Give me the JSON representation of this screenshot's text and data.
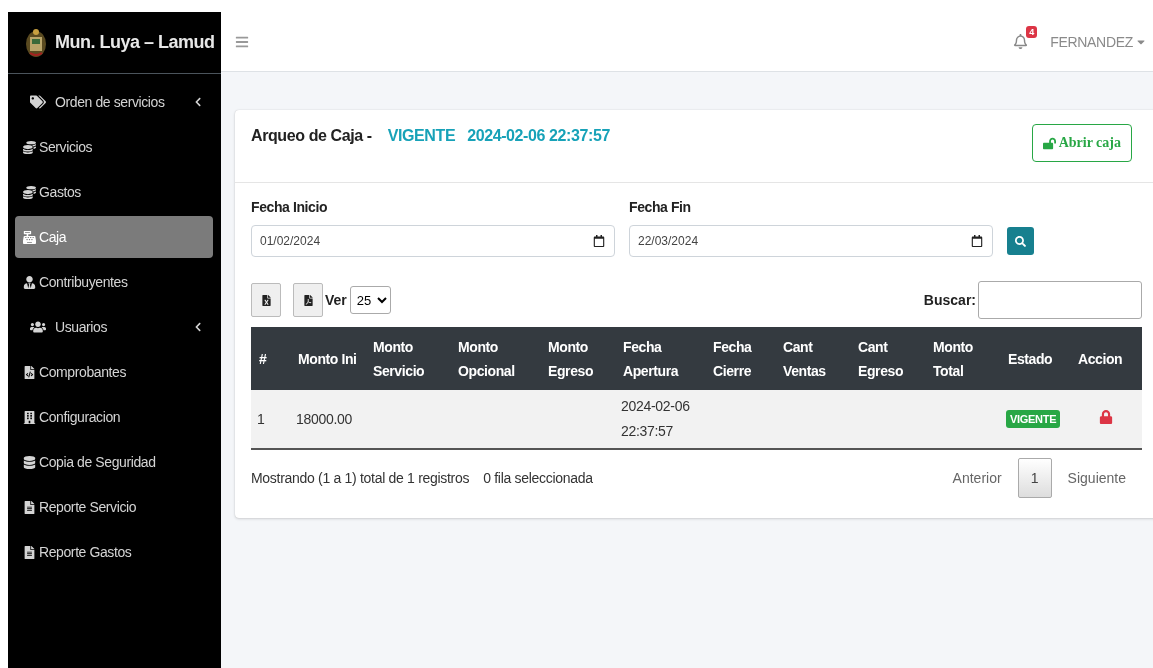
{
  "sidebar": {
    "brand": "Mun. Luya – Lamud",
    "items": [
      {
        "label": "Orden de servicios",
        "submenu": true,
        "selected": false
      },
      {
        "label": "Servicios",
        "submenu": false,
        "selected": false
      },
      {
        "label": "Gastos",
        "submenu": false,
        "selected": false
      },
      {
        "label": "Caja",
        "submenu": false,
        "selected": true
      },
      {
        "label": "Contribuyentes",
        "submenu": false,
        "selected": false
      },
      {
        "label": "Usuarios",
        "submenu": true,
        "selected": false
      },
      {
        "label": "Comprobantes",
        "submenu": false,
        "selected": false
      },
      {
        "label": "Configuracion",
        "submenu": false,
        "selected": false
      },
      {
        "label": "Copia de Seguridad",
        "submenu": false,
        "selected": false
      },
      {
        "label": "Reporte Servicio",
        "submenu": false,
        "selected": false
      },
      {
        "label": "Reporte Gastos",
        "submenu": false,
        "selected": false
      }
    ]
  },
  "topbar": {
    "notifications": "4",
    "user": "FERNANDEZ"
  },
  "card": {
    "title": "Arqueo de Caja -",
    "status": "VIGENTE",
    "datetime": "2024-02-06 22:37:57",
    "open_button": "Abrir caja"
  },
  "filters": [
    {
      "label": "Fecha Inicio",
      "value": "01/02/2024"
    },
    {
      "label": "Fecha Fin",
      "value": "22/03/2024"
    }
  ],
  "table_controls": {
    "show_label": "Ver",
    "page_size": "25",
    "search_label": "Buscar:"
  },
  "table": {
    "columns": [
      "#",
      "Monto Ini",
      "Monto Servicio",
      "Monto Opcional",
      "Monto Egreso",
      "Fecha Apertura",
      "Fecha Cierre",
      "Cant Ventas",
      "Cant Egreso",
      "Monto Total",
      "Estado",
      "Accion"
    ],
    "rows": [
      {
        "cells": [
          "1",
          "18000.00",
          null,
          null,
          null,
          "2024-02-06 22:37:57",
          null,
          null,
          null,
          null
        ],
        "status": "VIGENTE"
      }
    ]
  },
  "footer": {
    "info": "Mostrando (1 a 1) total de 1 registros",
    "selected_info": "0 fila seleccionada",
    "prev": "Anterior",
    "pages": [
      {
        "label": "1",
        "selected": true
      }
    ],
    "next": "Siguiente"
  }
}
